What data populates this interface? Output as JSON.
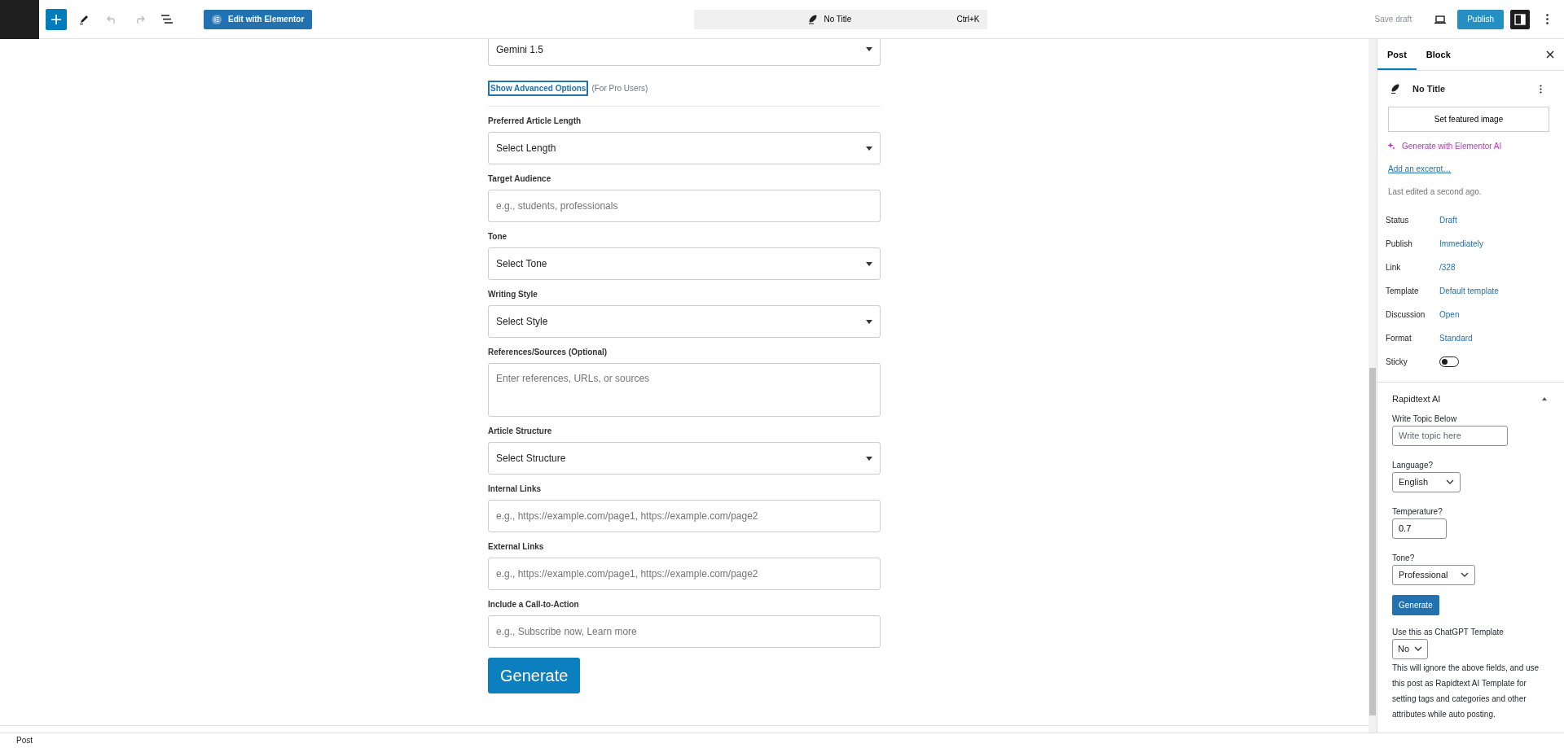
{
  "toolbar": {
    "elementor_button": "Edit with Elementor",
    "command": {
      "title": "No Title",
      "shortcut": "Ctrl+K"
    },
    "save_draft": "Save draft",
    "publish": "Publish",
    "sidebar_open": true
  },
  "form": {
    "model_select": {
      "value": "Gemini 1.5"
    },
    "advanced_link": "Show Advanced Options",
    "advanced_note": "(For Pro Users)",
    "fields": [
      {
        "label": "Preferred Article Length",
        "kind": "select",
        "value": "Select Length"
      },
      {
        "label": "Target Audience",
        "kind": "input",
        "placeholder": "e.g., students, professionals"
      },
      {
        "label": "Tone",
        "kind": "select",
        "value": "Select Tone"
      },
      {
        "label": "Writing Style",
        "kind": "select",
        "value": "Select Style"
      },
      {
        "label": "References/Sources (Optional)",
        "kind": "textarea",
        "placeholder": "Enter references, URLs, or sources"
      },
      {
        "label": "Article Structure",
        "kind": "select",
        "value": "Select Structure"
      },
      {
        "label": "Internal Links",
        "kind": "input",
        "placeholder": "e.g., https://example.com/page1, https://example.com/page2"
      },
      {
        "label": "External Links",
        "kind": "input",
        "placeholder": "e.g., https://example.com/page1, https://example.com/page2"
      },
      {
        "label": "Include a Call-to-Action",
        "kind": "input",
        "placeholder": "e.g., Subscribe now, Learn more"
      }
    ],
    "generate": "Generate"
  },
  "sidebar": {
    "tabs": [
      {
        "label": "Post",
        "selected": true
      },
      {
        "label": "Block",
        "selected": false
      }
    ],
    "post_title": "No Title",
    "featured_button": "Set featured image",
    "ai_link": "Generate with Elementor AI",
    "excerpt_link": "Add an excerpt…",
    "last_edited": "Last edited a second ago.",
    "properties": [
      {
        "label": "Status",
        "kind": "link",
        "value": "Draft"
      },
      {
        "label": "Publish",
        "kind": "link",
        "value": "Immediately"
      },
      {
        "label": "Link",
        "kind": "link",
        "value": "/328"
      },
      {
        "label": "Template",
        "kind": "link",
        "value": "Default template"
      },
      {
        "label": "Discussion",
        "kind": "link",
        "value": "Open"
      },
      {
        "label": "Format",
        "kind": "link",
        "value": "Standard"
      },
      {
        "label": "Sticky",
        "kind": "toggle",
        "on": false
      }
    ],
    "panel": {
      "title": "Rapidtext AI",
      "expanded": true,
      "fields": [
        {
          "label": "Write Topic Below",
          "kind": "input",
          "placeholder": "Write topic here"
        },
        {
          "label": "Language?",
          "kind": "select",
          "value": "English"
        },
        {
          "label": "Temperature?",
          "kind": "input",
          "value": "0.7"
        },
        {
          "label": "Tone?",
          "kind": "select",
          "value": "Professional"
        }
      ],
      "generate": "Generate",
      "template": {
        "label": "Use this as ChatGPT Template",
        "value": "No"
      },
      "note": "This will ignore the above fields, and use this post as Rapidtext AI Template for setting tags and categories and other attributes while auto posting."
    }
  },
  "status_bar": "Post"
}
